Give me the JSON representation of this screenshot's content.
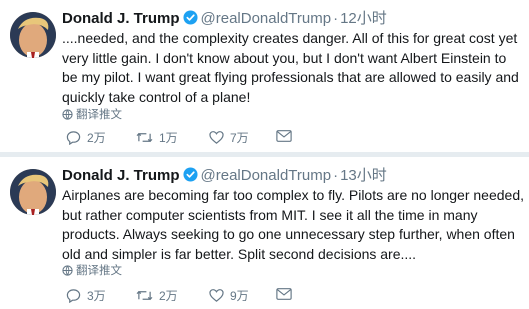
{
  "tweets": [
    {
      "name": "Donald J. Trump",
      "handle": "@realDonaldTrump",
      "separator": "·",
      "time": "12小时",
      "text": "....needed, and the complexity creates danger. All of this for great cost yet very little gain. I don't know about you, but I don't want Albert Einstein to be my pilot. I want great flying professionals that are allowed to easily and quickly take control of a plane!",
      "translate_label": "翻译推文",
      "replies": "2万",
      "retweets": "1万",
      "likes": "7万"
    },
    {
      "name": "Donald J. Trump",
      "handle": "@realDonaldTrump",
      "separator": "·",
      "time": "13小时",
      "text": "Airplanes are becoming far too complex to fly. Pilots are no longer needed, but rather computer scientists from MIT. I see it all the time in many products. Always seeking to go one unnecessary step further, when often old and simpler is far better. Split second decisions are....",
      "translate_label": "翻译推文",
      "replies": "3万",
      "retweets": "2万",
      "likes": "9万"
    }
  ],
  "colors": {
    "text": "#14171a",
    "muted": "#657786",
    "verified": "#1da1f2",
    "separator": "#e6ecf0"
  },
  "icons": [
    "verified-badge-icon",
    "globe-icon",
    "reply-icon",
    "retweet-icon",
    "like-icon",
    "direct-message-icon"
  ]
}
